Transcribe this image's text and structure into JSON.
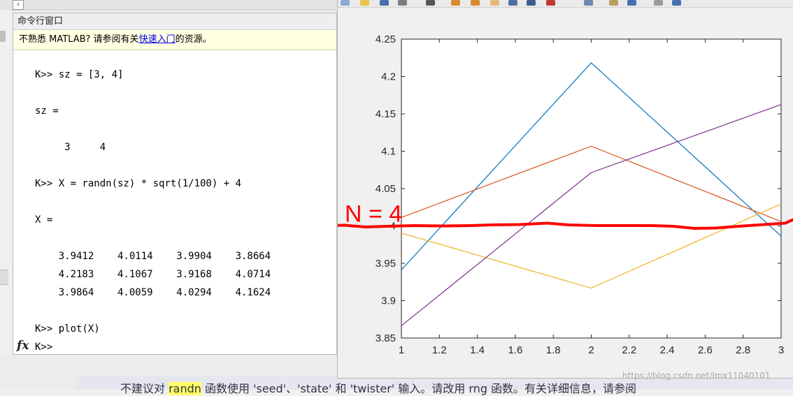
{
  "command_window": {
    "title": "命令行窗口",
    "notice": {
      "prefix": "不熟悉 MATLAB? 请参阅有关",
      "link": "快速入门",
      "suffix": "的资源。"
    },
    "lines": [
      "K>> sz = [3, 4]",
      "sz =",
      "     3     4",
      "K>> X = randn(sz) * sqrt(1/100) + 4",
      "X =",
      "    3.9412    4.0114    3.9904    3.8664",
      "    4.2183    4.1067    3.9168    4.0714",
      "    3.9864    4.0059    4.0294    4.1624",
      "K>> plot(X)",
      "K>>"
    ],
    "fx_label": "fx"
  },
  "figure": {
    "annotation": "N = 4"
  },
  "chart_data": {
    "type": "line",
    "x": [
      1,
      2,
      3
    ],
    "xlim": [
      1,
      3
    ],
    "ylim": [
      3.85,
      4.25
    ],
    "xticks": [
      1,
      1.2,
      1.4,
      1.6,
      1.8,
      2,
      2.2,
      2.4,
      2.6,
      2.8,
      3
    ],
    "xtick_labels": [
      "1",
      "1.2",
      "1.4",
      "1.6",
      "1.8",
      "2",
      "2.2",
      "2.4",
      "2.6",
      "2.8",
      "3"
    ],
    "yticks": [
      3.85,
      3.9,
      3.95,
      4,
      4.05,
      4.1,
      4.15,
      4.2,
      4.25
    ],
    "ytick_labels": [
      "3.85",
      "3.9",
      "3.95",
      "4",
      "4.05",
      "4.1",
      "4.15",
      "4.2",
      "4.25"
    ],
    "grid": false,
    "series": [
      {
        "values": [
          3.9412,
          4.2183,
          3.9864
        ],
        "color": "#0072bd"
      },
      {
        "values": [
          4.0114,
          4.1067,
          4.0059
        ],
        "color": "#d95319"
      },
      {
        "values": [
          3.9904,
          3.9168,
          4.0294
        ],
        "color": "#edb120"
      },
      {
        "values": [
          3.8664,
          4.0714,
          4.1624
        ],
        "color": "#7e2f8e"
      }
    ],
    "annotation_color": "#ff0000"
  },
  "footer": {
    "prefix": "不建议对 ",
    "highlight": "randn",
    "suffix": " 函数使用 'seed'、'state' 和 'twister' 输入。请改用 rng 函数。有关详细信息，请参阅"
  },
  "watermark": "https://blog.csdn.net/lmx11040101"
}
